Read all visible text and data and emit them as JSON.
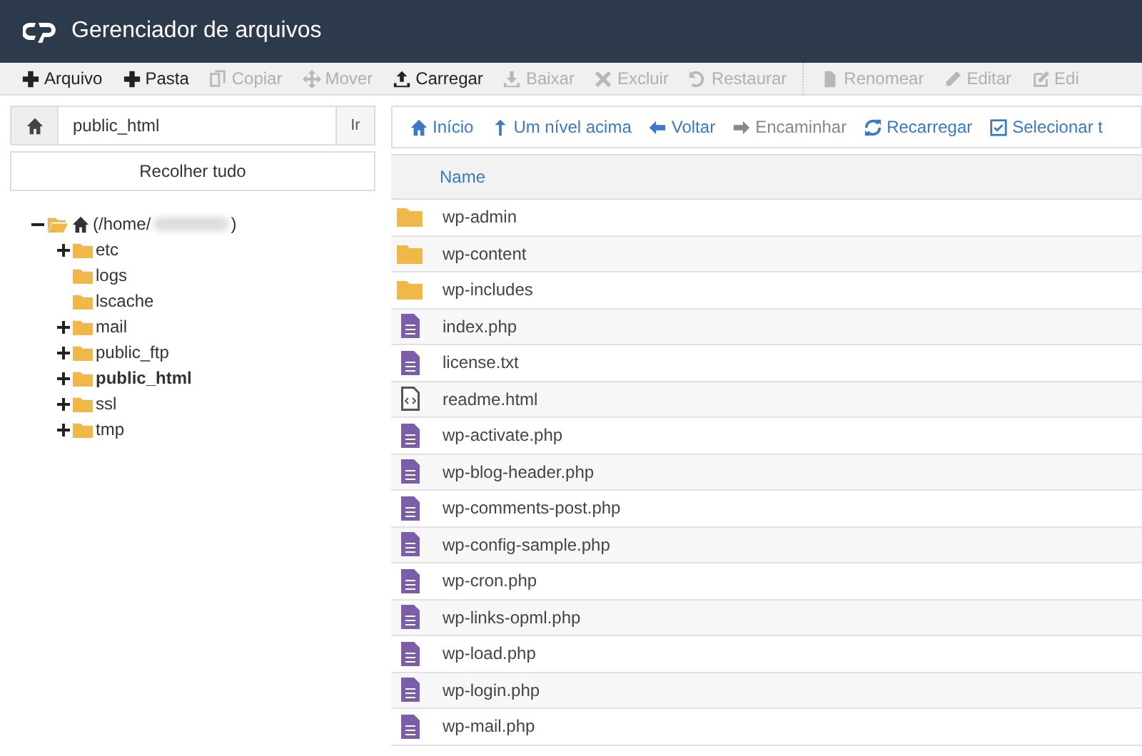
{
  "window": {
    "title": "Gerenciador de arquivos"
  },
  "toolbar": [
    {
      "label": "Arquivo",
      "disabled": false
    },
    {
      "label": "Pasta",
      "disabled": false
    },
    {
      "label": "Copiar",
      "disabled": true
    },
    {
      "label": "Mover",
      "disabled": true
    },
    {
      "label": "Carregar",
      "disabled": false
    },
    {
      "label": "Baixar",
      "disabled": true
    },
    {
      "label": "Excluir",
      "disabled": true
    },
    {
      "label": "Restaurar",
      "disabled": true
    },
    {
      "label": "Renomear",
      "disabled": true
    },
    {
      "label": "Editar",
      "disabled": true
    },
    {
      "label": "Edi",
      "disabled": true
    }
  ],
  "path_bar": {
    "value": "public_html",
    "button": "Ir"
  },
  "collapse_button": "Recolher tudo",
  "tree": [
    {
      "label": "(/home/",
      "suffix": ")",
      "expanded": true,
      "selected": false,
      "children": [
        {
          "label": "etc",
          "expanded": false,
          "selected": false
        },
        {
          "label": "logs",
          "selected": false
        },
        {
          "label": "lscache",
          "selected": false
        },
        {
          "label": "mail",
          "expanded": false,
          "selected": false
        },
        {
          "label": "public_ftp",
          "expanded": false,
          "selected": false
        },
        {
          "label": "public_html",
          "expanded": false,
          "selected": true
        },
        {
          "label": "ssl",
          "expanded": false,
          "selected": false
        },
        {
          "label": "tmp",
          "expanded": false,
          "selected": false
        }
      ]
    }
  ],
  "nav": [
    {
      "label": "Início",
      "disabled": false
    },
    {
      "label": "Um nível acima",
      "disabled": false
    },
    {
      "label": "Voltar",
      "disabled": false
    },
    {
      "label": "Encaminhar",
      "disabled": true
    },
    {
      "label": "Recarregar",
      "disabled": false
    },
    {
      "label": "Selecionar t",
      "disabled": false
    }
  ],
  "table": {
    "columns": [
      "Name"
    ],
    "rows": [
      {
        "kind": "folder",
        "name": "wp-admin"
      },
      {
        "kind": "folder",
        "name": "wp-content"
      },
      {
        "kind": "folder",
        "name": "wp-includes"
      },
      {
        "kind": "file",
        "name": "index.php"
      },
      {
        "kind": "file",
        "name": "license.txt"
      },
      {
        "kind": "code",
        "name": "readme.html"
      },
      {
        "kind": "file",
        "name": "wp-activate.php"
      },
      {
        "kind": "file",
        "name": "wp-blog-header.php"
      },
      {
        "kind": "file",
        "name": "wp-comments-post.php"
      },
      {
        "kind": "file",
        "name": "wp-config-sample.php"
      },
      {
        "kind": "file",
        "name": "wp-cron.php"
      },
      {
        "kind": "file",
        "name": "wp-links-opml.php"
      },
      {
        "kind": "file",
        "name": "wp-load.php"
      },
      {
        "kind": "file",
        "name": "wp-login.php"
      },
      {
        "kind": "file",
        "name": "wp-mail.php"
      }
    ]
  }
}
